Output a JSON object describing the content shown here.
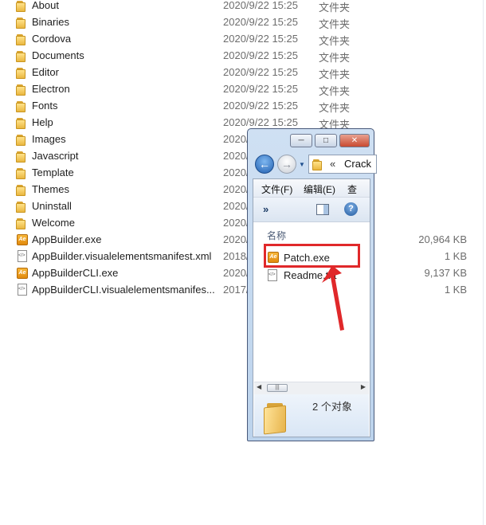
{
  "files": [
    {
      "name": "About",
      "date": "2020/9/22 15:25",
      "type": "文件夹",
      "size": "",
      "kind": "folder"
    },
    {
      "name": "Binaries",
      "date": "2020/9/22 15:25",
      "type": "文件夹",
      "size": "",
      "kind": "folder"
    },
    {
      "name": "Cordova",
      "date": "2020/9/22 15:25",
      "type": "文件夹",
      "size": "",
      "kind": "folder"
    },
    {
      "name": "Documents",
      "date": "2020/9/22 15:25",
      "type": "文件夹",
      "size": "",
      "kind": "folder"
    },
    {
      "name": "Editor",
      "date": "2020/9/22 15:25",
      "type": "文件夹",
      "size": "",
      "kind": "folder"
    },
    {
      "name": "Electron",
      "date": "2020/9/22 15:25",
      "type": "文件夹",
      "size": "",
      "kind": "folder"
    },
    {
      "name": "Fonts",
      "date": "2020/9/22 15:25",
      "type": "文件夹",
      "size": "",
      "kind": "folder"
    },
    {
      "name": "Help",
      "date": "2020/9/22 15:25",
      "type": "文件夹",
      "size": "",
      "kind": "folder"
    },
    {
      "name": "Images",
      "date": "2020/",
      "type": "",
      "size": "",
      "kind": "folder"
    },
    {
      "name": "Javascript",
      "date": "2020/",
      "type": "",
      "size": "",
      "kind": "folder"
    },
    {
      "name": "Template",
      "date": "2020/",
      "type": "",
      "size": "",
      "kind": "folder"
    },
    {
      "name": "Themes",
      "date": "2020/",
      "type": "",
      "size": "",
      "kind": "folder"
    },
    {
      "name": "Uninstall",
      "date": "2020/",
      "type": "",
      "size": "",
      "kind": "folder"
    },
    {
      "name": "Welcome",
      "date": "2020/",
      "type": "",
      "size": "",
      "kind": "folder"
    },
    {
      "name": "AppBuilder.exe",
      "date": "2020/",
      "type": "",
      "size": "20,964 KB",
      "kind": "exe"
    },
    {
      "name": "AppBuilder.visualelementsmanifest.xml",
      "date": "2018/",
      "type": "",
      "size": "1 KB",
      "kind": "manifest"
    },
    {
      "name": "AppBuilderCLI.exe",
      "date": "2020/",
      "type": "",
      "size": "9,137 KB",
      "kind": "exe"
    },
    {
      "name": "AppBuilderCLI.visualelementsmanifes...",
      "date": "2017/",
      "type": "",
      "size": "1 KB",
      "kind": "manifest"
    }
  ],
  "popup": {
    "title_buttons": {
      "minimize": "─",
      "maximize": "□",
      "close": "✕"
    },
    "address": {
      "chevron": "«",
      "folder": "Crack"
    },
    "menu": {
      "file": "文件(F)",
      "edit": "编辑(E)",
      "view": "查"
    },
    "toolbar": {
      "more": "»",
      "help": "?"
    },
    "column_header": "名称",
    "items": [
      {
        "name": "Patch.exe",
        "kind": "exe"
      },
      {
        "name": "Readme.txt",
        "kind": "manifest"
      }
    ],
    "status": "2 个对象",
    "colors": {
      "highlight": "#e0282a",
      "arrow": "#e0282a"
    }
  }
}
